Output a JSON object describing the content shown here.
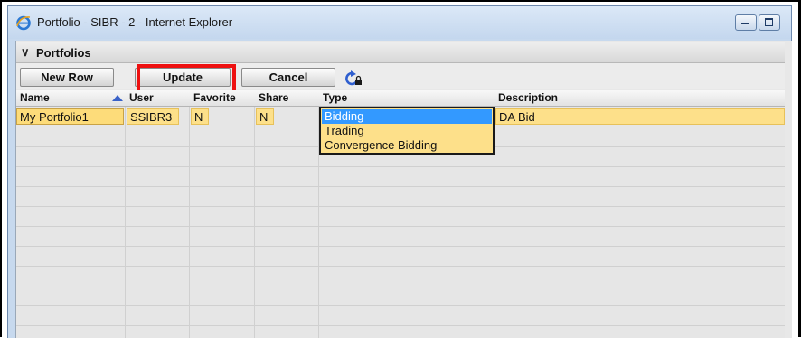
{
  "window": {
    "title": "Portfolio - SIBR - 2 - Internet Explorer"
  },
  "section": {
    "title": "Portfolios",
    "collapse_icon": "chevron-down-icon"
  },
  "toolbar": {
    "new_row_label": "New Row",
    "update_label": "Update",
    "cancel_label": "Cancel",
    "refresh_icon": "refresh-lock-icon"
  },
  "table": {
    "columns": [
      "Name",
      "User",
      "Favorite",
      "Share",
      "Type",
      "Description"
    ],
    "sort_column": "Name",
    "sort_direction": "ascending",
    "rows": [
      {
        "name": "My Portfolio1",
        "user": "SSIBR3",
        "favorite": "N",
        "share": "N",
        "type": "Bidding",
        "description": "DA Bid"
      }
    ]
  },
  "type_dropdown": {
    "selected": "Bidding",
    "options": [
      "Bidding",
      "Trading",
      "Convergence Bidding"
    ]
  },
  "colors": {
    "row_highlight": "#fde08a",
    "dropdown_selected": "#3399ff",
    "update_outline": "#ee1111"
  }
}
